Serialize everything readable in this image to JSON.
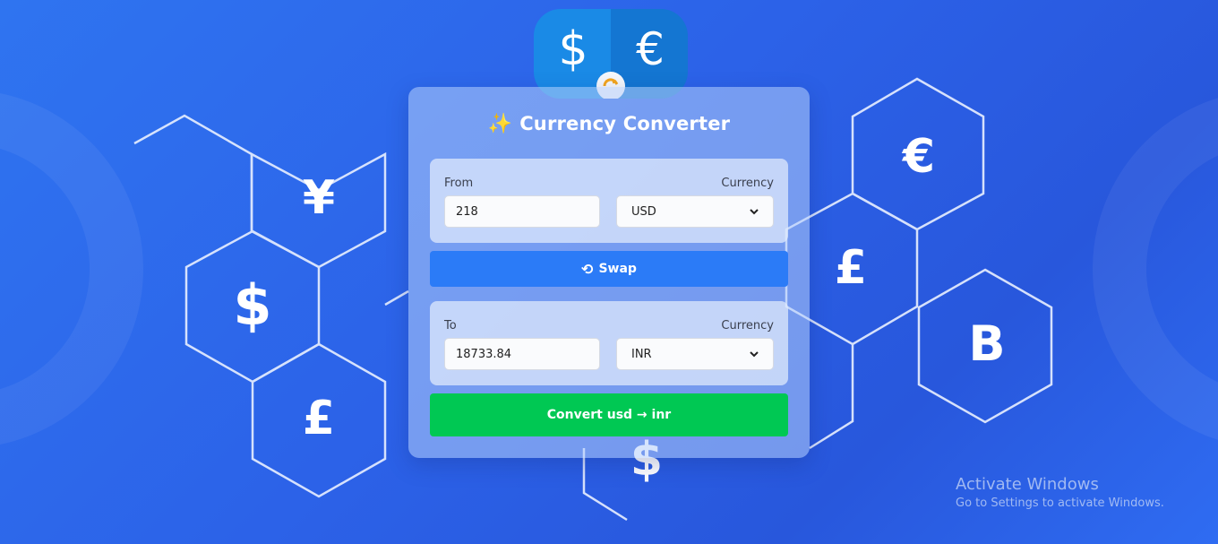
{
  "background": {
    "symbols": {
      "yen": "¥",
      "dollar_left": "$",
      "pound_left": "£",
      "dollar_bottom": "$",
      "euro_right": "€",
      "pound_right": "£",
      "bitcoin": "B"
    }
  },
  "logo": {
    "left_symbol": "$",
    "right_symbol": "€"
  },
  "header": {
    "icon": "✨",
    "title": "Currency Converter"
  },
  "from_panel": {
    "label": "From",
    "currency_label": "Currency",
    "amount_value": "218",
    "currency_value": "USD"
  },
  "swap": {
    "icon": "⟲",
    "label": "Swap"
  },
  "to_panel": {
    "label": "To",
    "currency_label": "Currency",
    "amount_value": "18733.84",
    "currency_value": "INR"
  },
  "convert": {
    "label": "Convert usd → inr"
  },
  "watermark": {
    "line1": "Activate Windows",
    "line2": "Go to Settings to activate Windows."
  },
  "colors": {
    "background": "#2c62e8",
    "swap_button": "#2b7bf7",
    "convert_button": "#00c853",
    "text_white": "#ffffff"
  }
}
